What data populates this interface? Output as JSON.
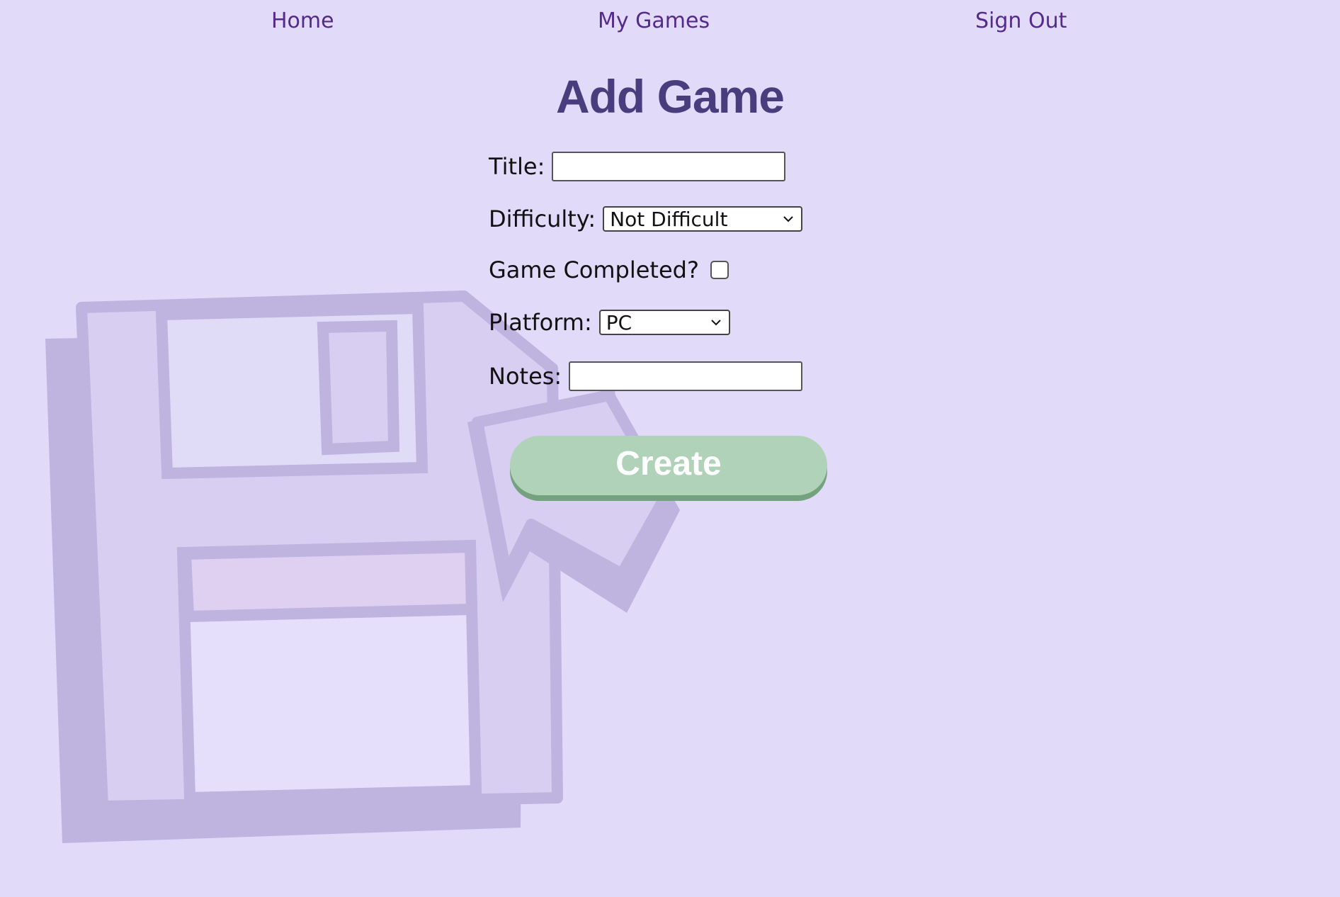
{
  "nav": {
    "home": "Home",
    "my_games": "My Games",
    "sign_out": "Sign Out"
  },
  "page": {
    "title": "Add Game"
  },
  "form": {
    "title_label": "Title:",
    "title_value": "",
    "difficulty_label": "Difficulty:",
    "difficulty_value": "Not Difficult",
    "completed_label": "Game Completed?",
    "completed_checked": false,
    "platform_label": "Platform:",
    "platform_value": "PC",
    "notes_label": "Notes:",
    "notes_value": "",
    "submit_label": "Create"
  },
  "background": {
    "icon": "floppy-disk-cursor-icon"
  },
  "colors": {
    "page_background": "#e1daf9",
    "nav_link": "#552a8c",
    "title": "#4a3d7e",
    "button": "#b0d2b9",
    "button_shadow": "#74a27e",
    "art_stroke": "#bfb3e0"
  }
}
